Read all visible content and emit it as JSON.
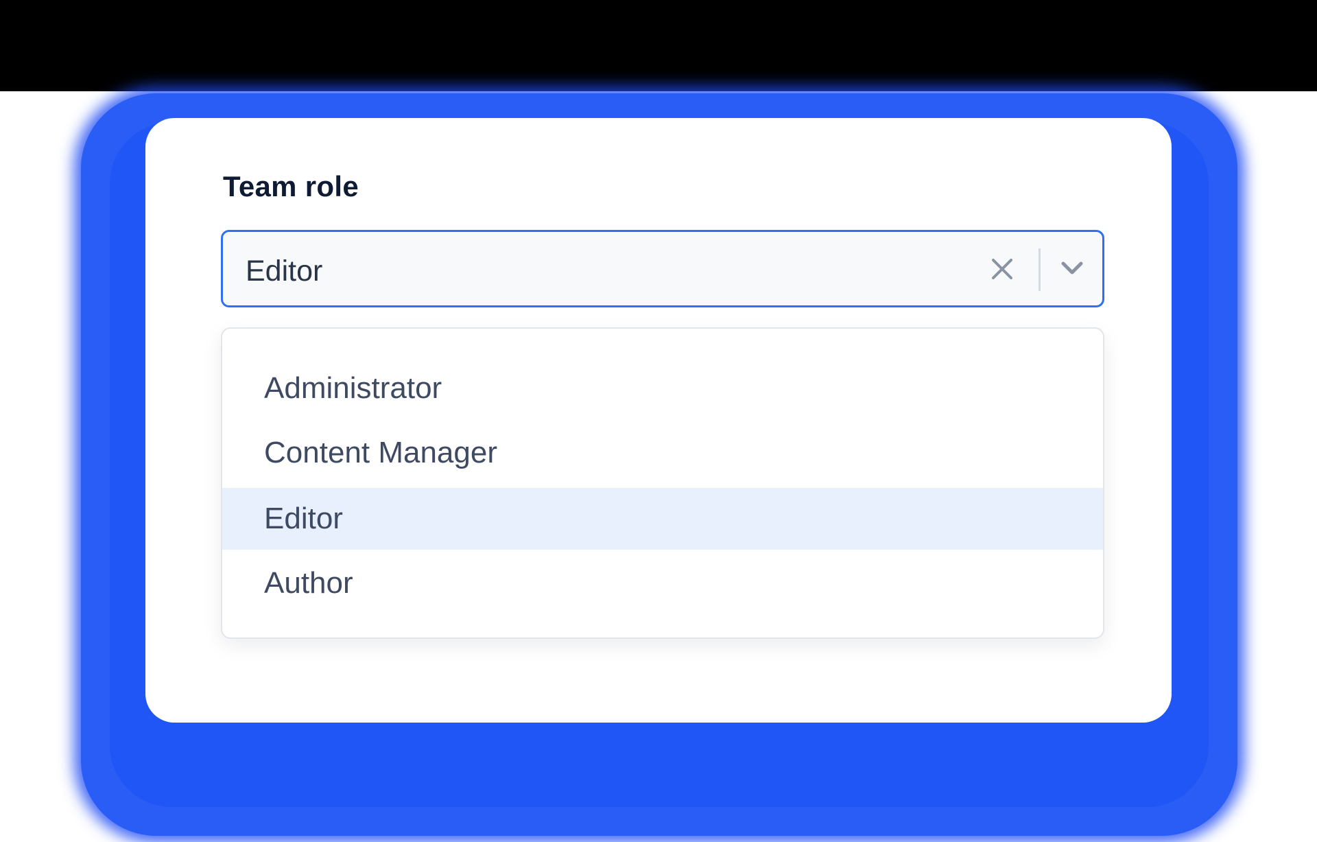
{
  "field": {
    "label": "Team role",
    "selected_value": "Editor"
  },
  "icons": {
    "clear": "close-icon",
    "toggle": "chevron-down-icon"
  },
  "options": [
    {
      "label": "Administrator",
      "selected": false
    },
    {
      "label": "Content Manager",
      "selected": false
    },
    {
      "label": "Editor",
      "selected": true
    },
    {
      "label": "Author",
      "selected": false
    }
  ],
  "colors": {
    "accent": "#2f6ff0",
    "selected_option_bg": "#e8effd",
    "glow": "#2a5cf6",
    "label_text": "#0f1b33",
    "option_text": "#3e4a62"
  }
}
